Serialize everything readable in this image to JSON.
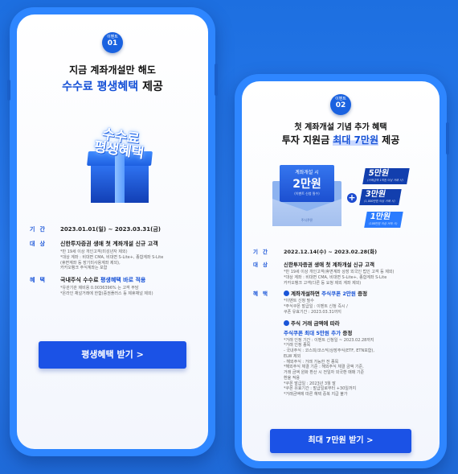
{
  "phone1": {
    "badge_top": "이벤트",
    "badge_num": "01",
    "title_line1": "지금 계좌개설만 해도",
    "title_blue": "수수료 평생혜택",
    "title_suffix": " 제공",
    "gift_line1": "수수료",
    "gift_line2": "평생혜택",
    "rows": [
      {
        "label": "기간",
        "value": "2023.01.01(일) ~ 2023.03.31(금)"
      },
      {
        "label": "대상",
        "value": "신한투자증권 생애 첫 계좌개설 신규 고객",
        "notes": [
          "*만 19세 이상 개인고객(미성년자 제외)",
          "*대상 계좌 : 비대면 CMA, 비대면 S-Lite+, 종합계좌 S-Lite",
          "(휴면계좌 등 장기미사용계좌 제외),",
          "카카오뱅크 주식계좌는 포함"
        ]
      },
      {
        "label": "혜택",
        "value_prefix": "국내주식 수수료 ",
        "value_blue": "평생혜택 바로 적용",
        "notes": [
          "*유관기관 제비용 0.0036396% 는 고객 부담",
          "*온라인 채널거래에 한함(증권플러스 등 제휴채널 제외)"
        ]
      }
    ],
    "cta": "평생혜택 받기 >"
  },
  "phone2": {
    "badge_top": "이벤트",
    "badge_num": "02",
    "title_line1": "첫 계좌개설 기념 추가 혜택",
    "title_prefix": "투자 지원금 ",
    "title_blue": "최대 7만원",
    "title_suffix": " 제공",
    "env_label": "계좌개설 시",
    "env_amount": "2만원",
    "env_note": "(이벤트 신청 필수)",
    "env_flap": "주식쿠폰",
    "tags": [
      {
        "amount": "5만원",
        "note": "(거래금액 1억원 이상 거래 시)"
      },
      {
        "amount": "3만원",
        "note": "(1,000만원 이상 거래 시)"
      },
      {
        "amount": "1만원",
        "note": "(100만원 이상 거래 시)"
      }
    ],
    "rows": [
      {
        "label": "기간",
        "value": "2022.12.14(수) ~ 2023.02.28(화)"
      },
      {
        "label": "대상",
        "value": "신한투자증권 생애 첫 계좌개설 신규 고객",
        "notes": [
          "*만 19세 이상 개인고객(휴면계좌 상장 외국인 법인 고객 등 제외)",
          "*대상 계좌 : 비대면 CMA, 비대면 S-Lite+, 종합계좌 S-Lite",
          "카카오뱅크 고객(다른 등 요청 제외 계좌 제외)"
        ]
      },
      {
        "label": "혜택",
        "b1_prefix": "계좌개설하면 ",
        "b1_blue": "주식쿠폰 2만원",
        "b1_suffix": " 증정",
        "b1_notes": [
          "*이벤트 신청 필수",
          "*주식쿠폰 발급일 : 이벤트 신청 즉시 /",
          "쿠폰 유효기간 : 2023.03.31까지"
        ],
        "b2_line1": "주식 거래 금액에 따라",
        "b2_blue": "주식쿠폰 최대 5만원 추가",
        "b2_suffix": " 증정",
        "b2_notes": [
          "*거래 인정 기간 : 이벤트 신청일 ~ 2023.02.28까지",
          "*거래 인정 종목",
          "- 국내주식 : 코스피/코스닥/상장주식(ETF, ETN포함),",
          "ELW 제외",
          "- 해외주식 : 거래 가능한 전 종목",
          "*해외주식 체결 기준 : 해외주식 체결 금액 기준,",
          "거래 금액 원화 환산 시 전일자 외국환 매매 기준",
          "환율 적용",
          "*쿠폰 발급일 : 2023년 3월 말",
          "*쿠폰 유효기간 : 발급일로부터 +30일까지",
          "*거래금액에 따른 혜택 중복 지급 불가"
        ]
      }
    ],
    "cta": "최대 7만원 받기 >"
  }
}
